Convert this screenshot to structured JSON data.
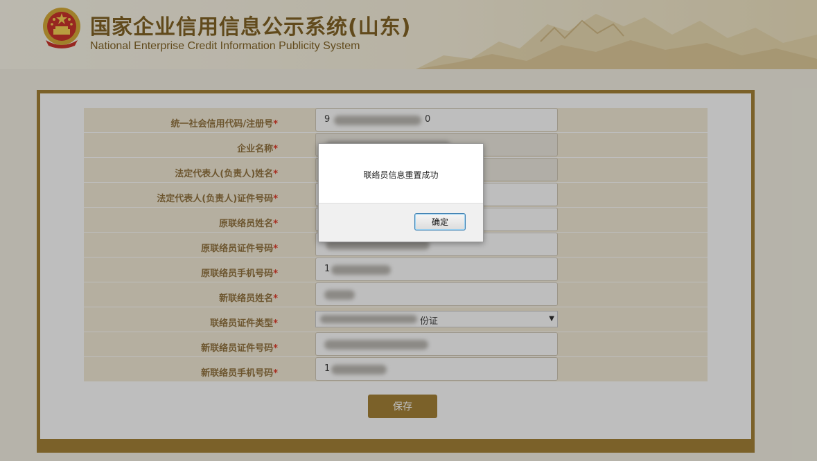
{
  "header": {
    "title": "国家企业信用信息公示系统(山东)",
    "subtitle": "National Enterprise Credit Information Publicity System",
    "colors": {
      "brand": "#7a5a17",
      "accent": "#a07a2a",
      "required": "#e0301e"
    }
  },
  "form": {
    "fields": [
      {
        "label": "统一社会信用代码/注册号",
        "required": "*",
        "value": "9",
        "value_tail": "0",
        "readonly": true
      },
      {
        "label": "企业名称",
        "required": "*",
        "value": "",
        "readonly": true
      },
      {
        "label": "法定代表人(负责人)姓名",
        "required": "*",
        "value": "",
        "readonly": true
      },
      {
        "label": "法定代表人(负责人)证件号码",
        "required": "*",
        "value": "",
        "readonly": false
      },
      {
        "label": "原联络员姓名",
        "required": "*",
        "value": "",
        "readonly": false
      },
      {
        "label": "原联络员证件号码",
        "required": "*",
        "value": "",
        "readonly": false
      },
      {
        "label": "原联络员手机号码",
        "required": "*",
        "value": "1",
        "readonly": false
      },
      {
        "label": "新联络员姓名",
        "required": "*",
        "value": "",
        "readonly": false
      },
      {
        "label": "联络员证件类型",
        "required": "*",
        "value": "份证",
        "readonly": false
      },
      {
        "label": "新联络员证件号码",
        "required": "*",
        "value": "",
        "readonly": false
      },
      {
        "label": "新联络员手机号码",
        "required": "*",
        "value": "1",
        "readonly": false
      }
    ],
    "save_label": "保存"
  },
  "dialog": {
    "message": "联络员信息重置成功",
    "ok_label": "确定"
  },
  "icons": [
    "national-emblem-icon",
    "mountain-scenery",
    "dropdown-arrow-icon"
  ]
}
